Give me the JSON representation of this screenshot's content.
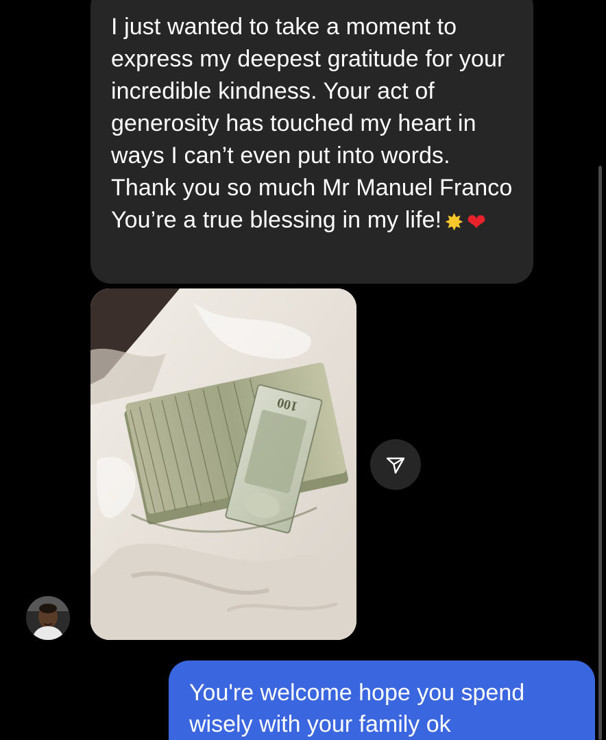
{
  "conversation": {
    "received_message": {
      "text": "I just wanted to take a moment to express my deepest gratitude for your incredible kindness. Your act of generosity has touched my heart in ways I can’t even put into words. Thank you so much Mr Manuel Franco You’re a true blessing in my life!",
      "emojis": [
        "glowing-star",
        "red-heart"
      ]
    },
    "photo": {
      "banknote_label": "100"
    },
    "share_icon": "paper-plane-icon",
    "sender_avatar_icon": "avatar-photo",
    "sent_message": {
      "text": "You're welcome hope you spend wisely with your family ok"
    }
  },
  "colors": {
    "background": "#000000",
    "received_bubble": "#262626",
    "sent_bubble": "#3a66e0",
    "text": "#ffffff"
  }
}
